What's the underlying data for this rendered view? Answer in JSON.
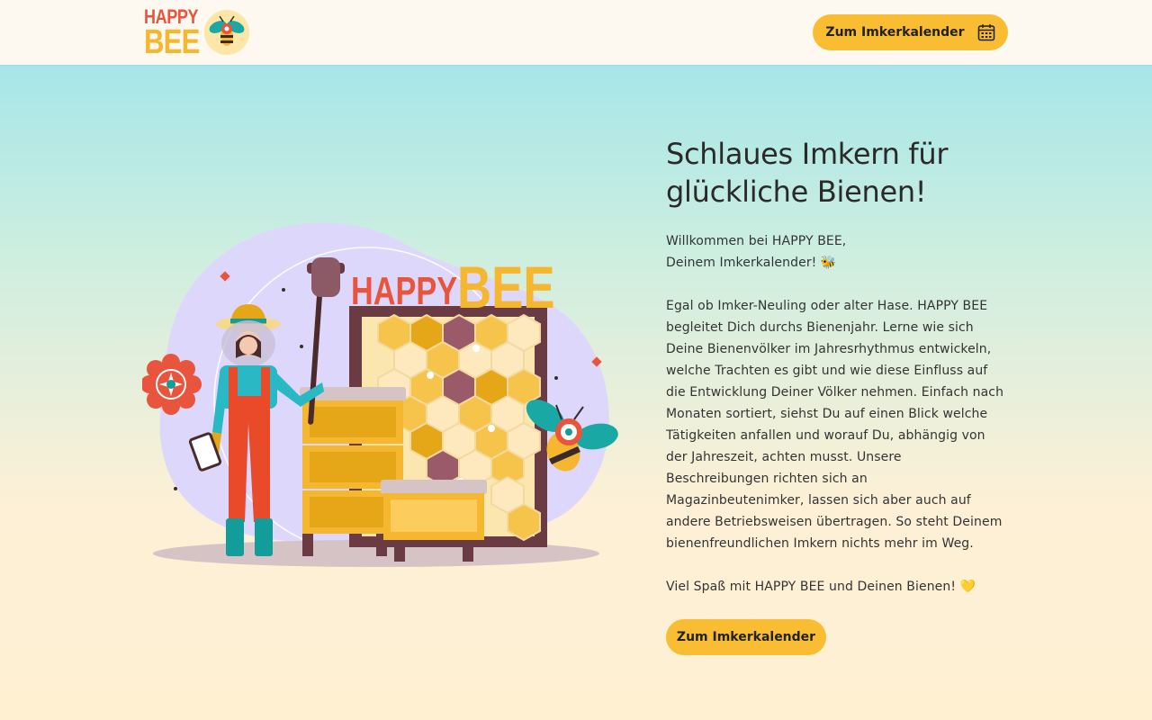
{
  "header": {
    "logo": {
      "line1": "HAPPY",
      "line2": "BEE",
      "badge_icon": "bee-badge-icon"
    },
    "button_label": "Zum Imkerkalender",
    "button_icon": "calendar-icon"
  },
  "hero": {
    "illustration": {
      "sign_line1": "HAPPY",
      "sign_line2": "BEE"
    }
  },
  "main": {
    "title": "Schlaues Imkern für glückliche Bienen!",
    "intro_line1": "Willkommen bei HAPPY BEE,",
    "intro_line2": "Deinem Imkerkalender!  🐝",
    "paragraph": "Egal ob Imker-Neuling oder alter Hase. HAPPY BEE begleitet Dich durchs Bienenjahr. Lerne wie sich Deine Bienenvölker im Jahresrhythmus entwickeln, welche Trachten es gibt und wie diese Einfluss auf die Entwicklung Deiner Völker nehmen. Einfach nach Monaten sortiert, siehst Du auf einen Blick welche Tätigkeiten anfallen und worauf Du, abhängig von der Jahreszeit, achten musst. Unsere Beschreibungen richten sich an Magazinbeutenimker, lassen sich aber auch auf andere Betriebsweisen übertragen. So steht Deinem bienenfreundlichen Imkern nichts mehr im Weg.",
    "closing": "Viel Spaß mit HAPPY BEE und Deinen Bienen! 💛",
    "cta_label": "Zum Imkerkalender"
  },
  "colors": {
    "accent": "#f8bd32",
    "brand_red": "#e8543c",
    "brand_yellow": "#f6b730",
    "teal": "#129c9a",
    "header_bg": "#fdf9f1"
  }
}
